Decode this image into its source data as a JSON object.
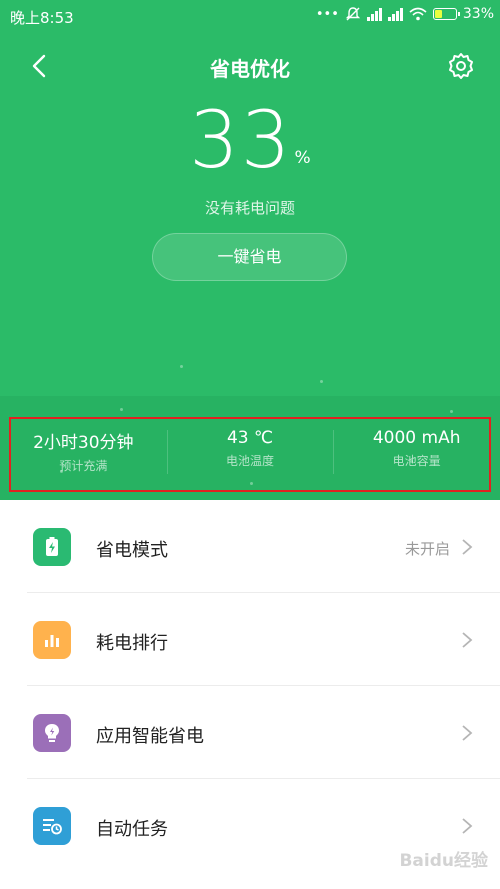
{
  "status_bar": {
    "time": "晚上8:53",
    "dots": "•••",
    "battery_percent": "33%",
    "battery_level": 0.33
  },
  "header": {
    "title": "省电优化",
    "back_icon": "chevron-left-icon",
    "settings_icon": "gear-icon"
  },
  "battery": {
    "percent_value": "33",
    "percent_unit": "%",
    "status_text": "没有耗电问题",
    "optimize_button": "一键省电"
  },
  "stats": [
    {
      "value": "2小时30分钟",
      "label": "预计充满"
    },
    {
      "value": "43 ℃",
      "label": "电池温度"
    },
    {
      "value": "4000 mAh",
      "label": "电池容量"
    }
  ],
  "menu": [
    {
      "label": "省电模式",
      "status": "未开启",
      "icon": "battery-charge-icon",
      "color": "#2aba72"
    },
    {
      "label": "耗电排行",
      "status": "",
      "icon": "bar-chart-icon",
      "color": "#ffb24d"
    },
    {
      "label": "应用智能省电",
      "status": "",
      "icon": "lightbulb-icon",
      "color": "#9b6fb8"
    },
    {
      "label": "自动任务",
      "status": "",
      "icon": "task-list-icon",
      "color": "#2f9fd6"
    }
  ],
  "watermark": "Baidu经验",
  "colors": {
    "hero_green": "#2bbb68",
    "highlight_red": "#e32020"
  }
}
